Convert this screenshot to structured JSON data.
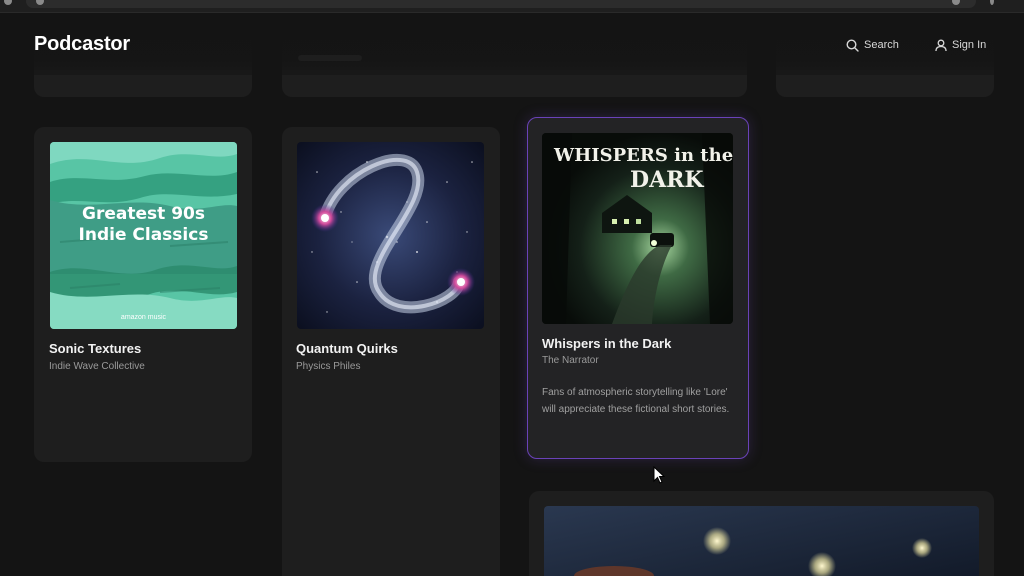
{
  "header": {
    "logo": "Podcastor",
    "search_label": "Search",
    "signin_label": "Sign In"
  },
  "cards": [
    {
      "title": "Sonic Textures",
      "author": "Indie Wave Collective",
      "cover_text": "Greatest 90s Indie Classics",
      "cover_brand": "amazon music"
    },
    {
      "title": "Quantum Quirks",
      "author": "Physics Philes"
    },
    {
      "title": "Whispers in the Dark",
      "author": "The Narrator",
      "description": "Fans of atmospheric storytelling like 'Lore' will appreciate these fictional short stories.",
      "cover_title_line1": "WHISPERS in the",
      "cover_title_line2": "DARK"
    }
  ],
  "colors": {
    "background": "#141414",
    "card": "#1e1e1e",
    "highlight_border": "#6a42b8",
    "text_primary": "#f2f2f2",
    "text_secondary": "#9a9a9a"
  }
}
